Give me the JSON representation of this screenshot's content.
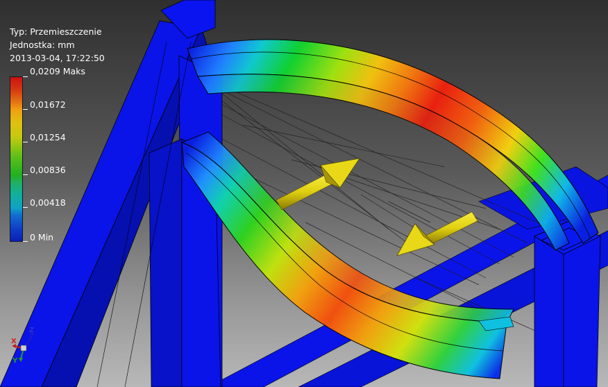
{
  "legend": {
    "type_line": "Typ: Przemieszczenie",
    "unit_line": "Jednostka: mm",
    "date_line": "2013-03-04, 17:22:50",
    "labels": [
      "0,0209 Maks",
      "0,01672",
      "0,01254",
      "0,00836",
      "0,00418",
      "0 Min"
    ],
    "max": 0.0209,
    "min": 0,
    "colors": {
      "high": "#cc1010",
      "mid": "#20b020",
      "low": "#0a20b8"
    }
  },
  "triad": {
    "x": "X",
    "y": "Y",
    "z": "Z"
  },
  "colors": {
    "frame": "#0a14e8",
    "frame_dark": "#0610b0",
    "arrow": "#e0cf10",
    "background_top": "#2f2f2f",
    "background_bottom": "#b8b8b8"
  }
}
